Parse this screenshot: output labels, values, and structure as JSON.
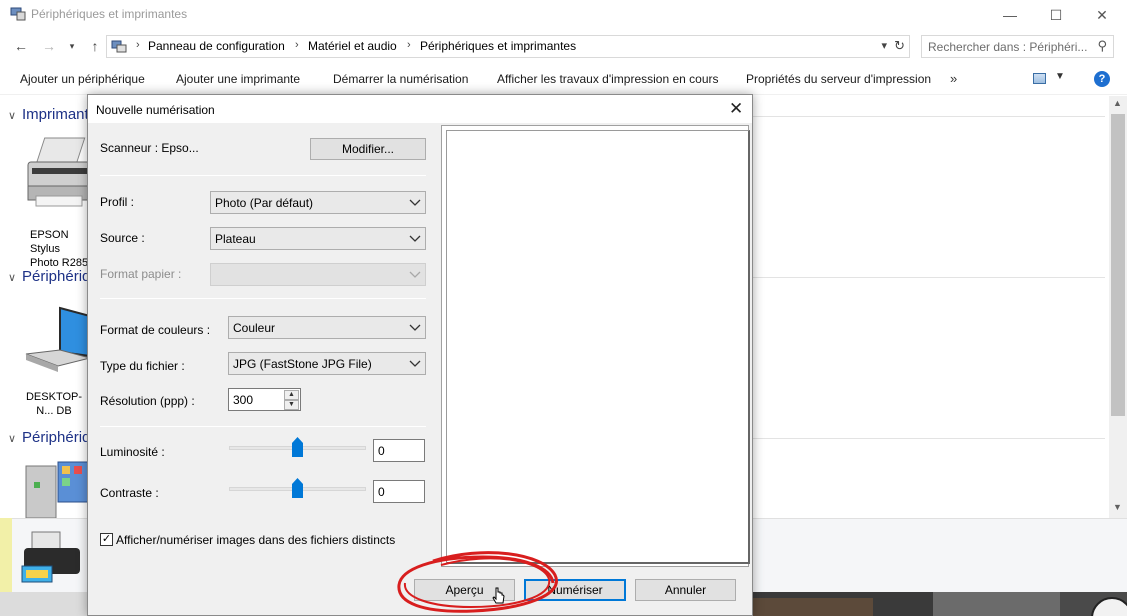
{
  "window": {
    "title": "Périphériques et imprimantes",
    "breadcrumbs": [
      "Panneau de configuration",
      "Matériel et audio",
      "Périphériques et imprimantes"
    ],
    "search_placeholder": "Rechercher dans : Périphéri...",
    "toolbar": {
      "add_device": "Ajouter un périphérique",
      "add_printer": "Ajouter une imprimante",
      "start_scan": "Démarrer la numérisation",
      "print_jobs": "Afficher les travaux d'impression en cours",
      "server_props": "Propriétés du serveur d'impression",
      "more": "»"
    },
    "groups": [
      {
        "label": "Imprimantes"
      },
      {
        "label": "Périphériques"
      },
      {
        "label": "Périphériques multimédias"
      }
    ],
    "devices": [
      {
        "label": "EPSON Stylus Photo R285"
      },
      {
        "label": "DESKTOP-N... DB"
      }
    ],
    "icons": [
      "back-icon",
      "forward-icon",
      "up-icon",
      "search-icon",
      "help-icon",
      "refresh-icon"
    ]
  },
  "dialog": {
    "title": "Nouvelle numérisation",
    "scanner_label": "Scanneur : Epso...",
    "modify_button": "Modifier...",
    "profile_label": "Profil :",
    "profile_value": "Photo (Par défaut)",
    "source_label": "Source :",
    "source_value": "Plateau",
    "paper_label": "Format papier :",
    "color_label": "Format de couleurs :",
    "color_value": "Couleur",
    "filetype_label": "Type du fichier :",
    "filetype_value": "JPG (FastStone JPG File)",
    "resolution_label": "Résolution (ppp) :",
    "resolution_value": "300",
    "brightness_label": "Luminosité :",
    "brightness_value": "0",
    "contrast_label": "Contraste :",
    "contrast_value": "0",
    "checkbox_label": "Afficher/numériser images dans des fichiers distincts",
    "checkbox_checked": true,
    "preview_button": "Aperçu",
    "scan_button": "Numériser",
    "cancel_button": "Annuler",
    "accent_color": "#0078d7",
    "annotation_color": "#d81e1e"
  }
}
